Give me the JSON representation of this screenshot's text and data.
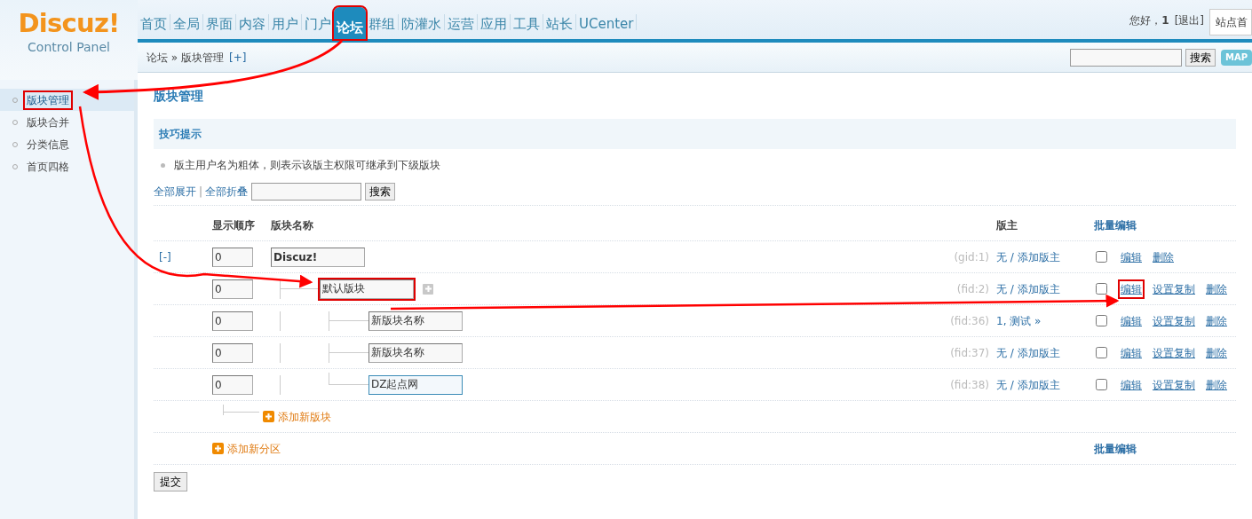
{
  "logo": {
    "title": "Discuz!",
    "subtitle": "Control Panel"
  },
  "nav": [
    {
      "label": "首页",
      "selected": false,
      "highlighted": false
    },
    {
      "label": "全局",
      "selected": false,
      "highlighted": false
    },
    {
      "label": "界面",
      "selected": false,
      "highlighted": false
    },
    {
      "label": "内容",
      "selected": false,
      "highlighted": false
    },
    {
      "label": "用户",
      "selected": false,
      "highlighted": false
    },
    {
      "label": "门户",
      "selected": false,
      "highlighted": false
    },
    {
      "label": "论坛",
      "selected": true,
      "highlighted": true
    },
    {
      "label": "群组",
      "selected": false,
      "highlighted": false
    },
    {
      "label": "防灌水",
      "selected": false,
      "highlighted": false
    },
    {
      "label": "运营",
      "selected": false,
      "highlighted": false
    },
    {
      "label": "应用",
      "selected": false,
      "highlighted": false
    },
    {
      "label": "工具",
      "selected": false,
      "highlighted": false
    },
    {
      "label": "站长",
      "selected": false,
      "highlighted": false
    },
    {
      "label": "UCenter",
      "selected": false,
      "highlighted": false
    }
  ],
  "user_bar": {
    "greeting": "您好，",
    "user": "1",
    "logout": "[退出]",
    "site_select": "站点首"
  },
  "breadcrumb": {
    "path": "论坛 » 版块管理",
    "add": "[+]",
    "search_button": "搜索",
    "map_button": "MAP"
  },
  "sidebar": {
    "items": [
      {
        "label": "版块管理",
        "selected": true,
        "highlighted": true
      },
      {
        "label": "版块合并",
        "selected": false,
        "highlighted": false
      },
      {
        "label": "分类信息",
        "selected": false,
        "highlighted": false
      },
      {
        "label": "首页四格",
        "selected": false,
        "highlighted": false
      }
    ]
  },
  "page_title": "版块管理",
  "tips": {
    "title": "技巧提示",
    "items": [
      "版主用户名为粗体，则表示该版主权限可继承到下级版块"
    ]
  },
  "toolbar": {
    "expand_all": "全部展开",
    "separator": "|",
    "collapse_all": "全部折叠",
    "search_button": "搜索"
  },
  "table": {
    "columns": [
      "显示顺序",
      "版块名称",
      "版主",
      "批量编辑"
    ],
    "rows": [
      {
        "kind": "group",
        "toggle": "[-]",
        "order": "0",
        "name": "Discuz!",
        "highlighted": false,
        "focused": false,
        "id": "(gid:1)",
        "moderator": "无 / 添加版主",
        "checked": false,
        "actions": [
          {
            "label": "编辑",
            "highlighted": false
          },
          {
            "label": "删除",
            "highlighted": false
          }
        ],
        "add_child": "添加新版块",
        "children": [
          {
            "kind": "forum",
            "order": "0",
            "name": "默认版块",
            "highlighted": true,
            "focused": false,
            "id": "(fid:2)",
            "moderator": "无 / 添加版主",
            "checked": false,
            "actions": [
              {
                "label": "编辑",
                "highlighted": true
              },
              {
                "label": "设置复制",
                "highlighted": false
              },
              {
                "label": "删除",
                "highlighted": false
              }
            ],
            "children": [
              {
                "kind": "subforum",
                "order": "0",
                "name": "新版块名称",
                "highlighted": false,
                "focused": false,
                "id": "(fid:36)",
                "moderator": "1, 测试 »",
                "checked": false,
                "actions": [
                  {
                    "label": "编辑",
                    "highlighted": false
                  },
                  {
                    "label": "设置复制",
                    "highlighted": false
                  },
                  {
                    "label": "删除",
                    "highlighted": false
                  }
                ]
              },
              {
                "kind": "subforum",
                "order": "0",
                "name": "新版块名称",
                "highlighted": false,
                "focused": false,
                "id": "(fid:37)",
                "moderator": "无 / 添加版主",
                "checked": false,
                "actions": [
                  {
                    "label": "编辑",
                    "highlighted": false
                  },
                  {
                    "label": "设置复制",
                    "highlighted": false
                  },
                  {
                    "label": "删除",
                    "highlighted": false
                  }
                ]
              },
              {
                "kind": "subforum",
                "order": "0",
                "name": "DZ起点网",
                "highlighted": false,
                "focused": true,
                "id": "(fid:38)",
                "moderator": "无 / 添加版主",
                "checked": false,
                "actions": [
                  {
                    "label": "编辑",
                    "highlighted": false
                  },
                  {
                    "label": "设置复制",
                    "highlighted": false
                  },
                  {
                    "label": "删除",
                    "highlighted": false
                  }
                ]
              }
            ]
          }
        ]
      }
    ],
    "add_group": "添加新分区",
    "batch_edit": "批量编辑"
  },
  "submit_button": "提交"
}
